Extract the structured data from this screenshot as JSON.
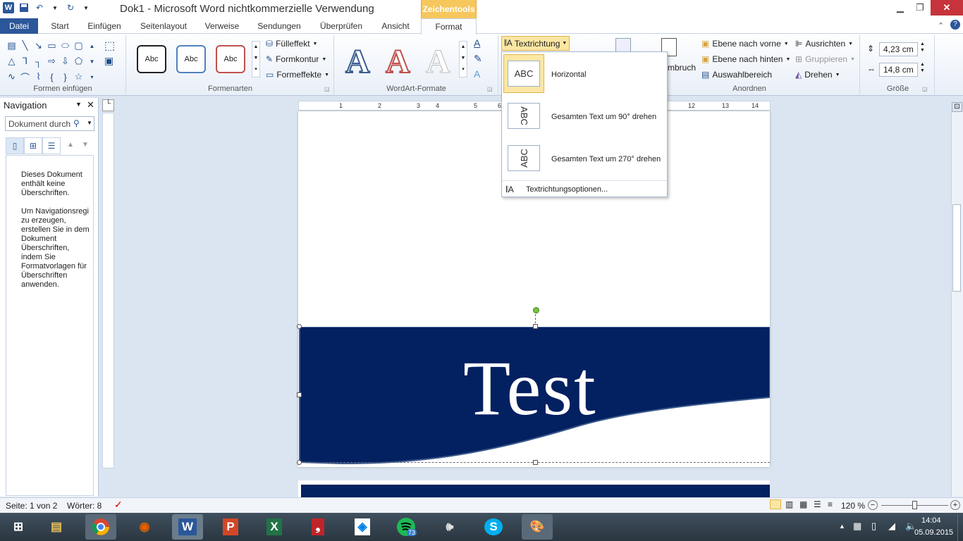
{
  "window": {
    "title": "Dok1 - Microsoft Word nichtkommerzielle Verwendung",
    "context_tab": "Zeichentools"
  },
  "tabs": [
    "Datei",
    "Start",
    "Einfügen",
    "Seitenlayout",
    "Verweise",
    "Sendungen",
    "Überprüfen",
    "Ansicht",
    "Format"
  ],
  "ribbon": {
    "groups": {
      "shapes": "Formen einfügen",
      "styles": "Formenarten",
      "wordart": "WordArt-Formate",
      "arrange": "Anordnen",
      "size": "Größe"
    },
    "style_samples": [
      "Abc",
      "Abc",
      "Abc"
    ],
    "fill": "Fülleffekt",
    "outline": "Formkontur",
    "effects": "Formeffekte",
    "textdir": "Textrichtung",
    "wrap_partial": "mbruch",
    "arrange": [
      "Ebene nach vorne",
      "Ebene nach hinten",
      "Auswahlbereich",
      "Ausrichten",
      "Gruppieren",
      "Drehen"
    ],
    "height": "4,23 cm",
    "width": "14,8 cm"
  },
  "dropdown": {
    "sample": "ABC",
    "items": [
      "Horizontal",
      "Gesamten Text um 90° drehen",
      "Gesamten Text um 270° drehen"
    ],
    "options": "Textrichtungsoptionen..."
  },
  "nav": {
    "title": "Navigation",
    "search_placeholder": "Dokument durch",
    "message": "Dieses Dokument enthält keine Überschriften.\n\nUm Navigationsregi zu erzeugen, erstellen Sie in dem Dokument Überschriften, indem Sie Formatvorlagen für Überschriften anwenden."
  },
  "document": {
    "text": "Test"
  },
  "ruler": {
    "h": [
      "1",
      "2",
      "3",
      "4",
      "5",
      "6",
      "12",
      "13",
      "14"
    ]
  },
  "status": {
    "page": "Seite: 1 von 2",
    "words": "Wörter: 8",
    "zoom": "120 %"
  },
  "taskbar": {
    "time": "14:04",
    "date": "05.09.2015",
    "spotify_badge": "73"
  },
  "colors": {
    "navy": "#032060",
    "accent": "#2b579a",
    "context": "#f6c75c"
  }
}
